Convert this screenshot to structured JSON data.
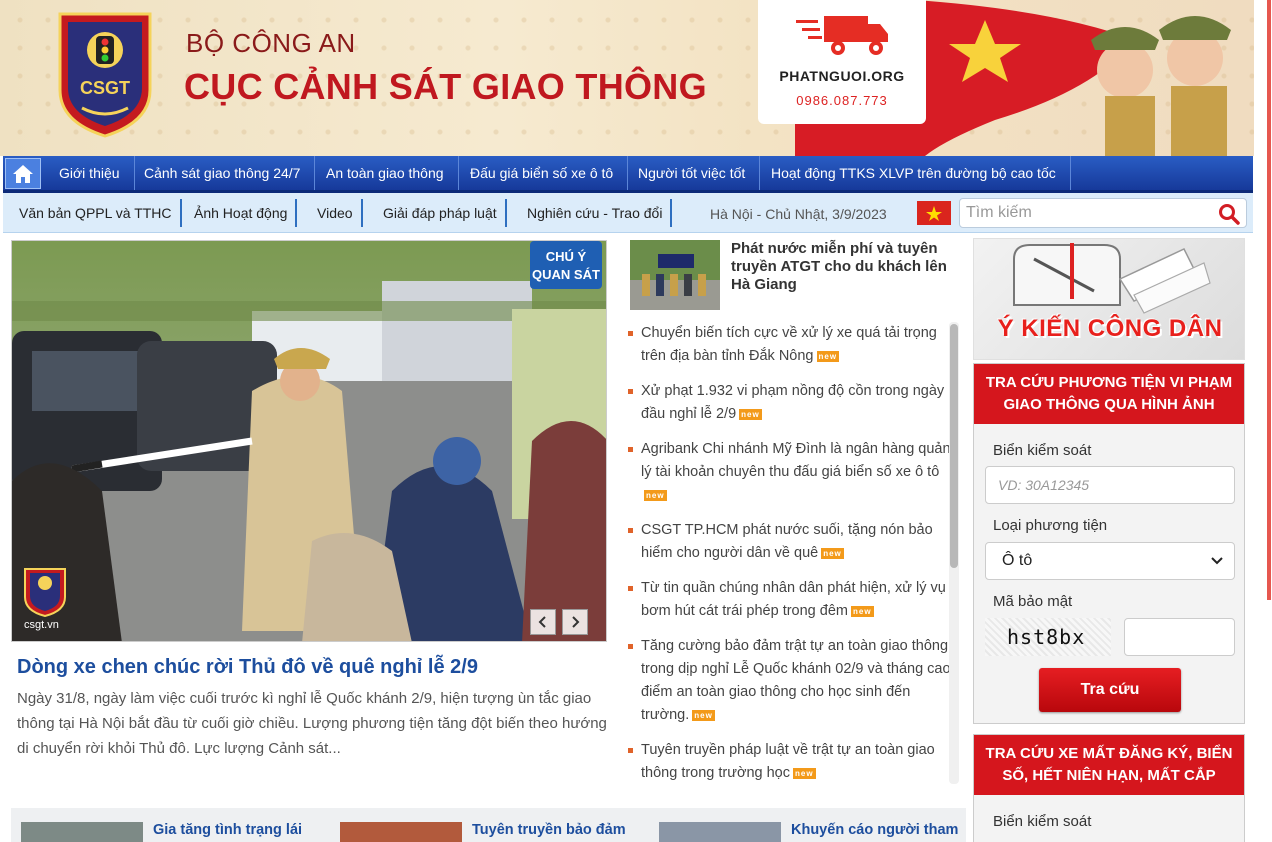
{
  "header": {
    "org_top": "BỘ CÔNG AN",
    "org_main": "CỤC CẢNH SÁT GIAO THÔNG",
    "logo_text": "CSGT",
    "ad_name": "PHATNGUOI.ORG",
    "ad_phone": "0986.087.773"
  },
  "nav_primary": {
    "home_icon": "home-icon",
    "items": [
      "Giới thiệu",
      "Cảnh sát giao thông 24/7",
      "An toàn giao thông",
      "Đấu giá biển số xe ô tô",
      "Người tốt việc tốt",
      "Hoạt động TTKS XLVP trên đường bộ cao tốc"
    ]
  },
  "nav_secondary": {
    "items": [
      "Văn bản QPPL và TTHC",
      "Ảnh Hoạt động",
      "Video",
      "Giải đáp pháp luật",
      "Nghiên cứu - Trao đổi"
    ],
    "date": "Hà Nội - Chủ Nhật, 3/9/2023",
    "search_placeholder": "Tìm kiếm"
  },
  "feature": {
    "sign_text_1": "CHÚ Ý",
    "sign_text_2": "QUAN SÁT",
    "watermark": "csgt.vn",
    "title": "Dòng xe chen chúc rời Thủ đô về quê nghỉ lễ 2/9",
    "summary": "Ngày 31/8, ngày làm việc cuối trước kì nghỉ lễ Quốc khánh 2/9, hiện tượng ùn tắc giao thông tại Hà Nội bắt đầu từ cuối giờ chiều. Lượng phương tiện tăng đột biến theo hướng di chuyển rời khỏi Thủ đô. Lực lượng Cảnh sát...",
    "prev_icon": "chevron-left-icon",
    "next_icon": "chevron-right-icon"
  },
  "top_news": {
    "title": "Phát nước miễn phí và tuyên truyền ATGT cho du khách lên Hà Giang"
  },
  "news_list": [
    {
      "text": "Chuyển biến tích cực về xử lý xe quá tải trọng trên địa bàn tỉnh Đắk Nông",
      "badge": "new"
    },
    {
      "text": "Xử phạt 1.932 vi phạm nồng độ cồn trong ngày đầu nghỉ lễ 2/9",
      "badge": "new"
    },
    {
      "text": "Agribank Chi nhánh Mỹ Đình là ngân hàng quản lý tài khoản chuyên thu đấu giá biển số xe ô tô",
      "badge": "new"
    },
    {
      "text": "CSGT TP.HCM phát nước suối, tặng nón bảo hiểm cho người dân về quê",
      "badge": "new"
    },
    {
      "text": "Từ tin quần chúng nhân dân phát hiện, xử lý vụ bơm hút cát trái phép trong đêm",
      "badge": "new"
    },
    {
      "text": "Tăng cường bảo đảm trật tự an toàn giao thông trong dịp nghỉ Lễ Quốc khánh 02/9 và tháng cao điểm an toàn giao thông cho học sinh đến trường.",
      "badge": "new"
    },
    {
      "text": "Tuyên truyền pháp luật về trật tự an toàn giao thông trong trường học",
      "badge": "new"
    }
  ],
  "bottom_cards": [
    {
      "title": "Gia tăng tình trạng lái"
    },
    {
      "title": "Tuyên truyền bảo đảm"
    },
    {
      "title": "Khuyến cáo người tham"
    }
  ],
  "sidebar": {
    "opinion_banner": "Ý KIẾN CÔNG DÂN",
    "lookup_violation": {
      "heading": "TRA CỨU PHƯƠNG TIỆN VI PHẠM GIAO THÔNG QUA HÌNH ẢNH",
      "plate_label": "Biển kiểm soát",
      "plate_placeholder": "VD: 30A12345",
      "type_label": "Loại phương tiện",
      "type_value": "Ô tô",
      "captcha_label": "Mã bảo mật",
      "captcha_text": "hst8bx",
      "submit_label": "Tra cứu"
    },
    "lookup_lost": {
      "heading": "TRA CỨU XE MẤT ĐĂNG KÝ, BIỂN SỐ, HẾT NIÊN HẠN, MẤT CẮP",
      "plate_label": "Biển kiểm soát"
    }
  },
  "colors": {
    "nav_blue": "#1f4bb0",
    "accent_red": "#d5161d",
    "link_blue": "#1d4e9e",
    "bullet_orange": "#e0632a"
  }
}
